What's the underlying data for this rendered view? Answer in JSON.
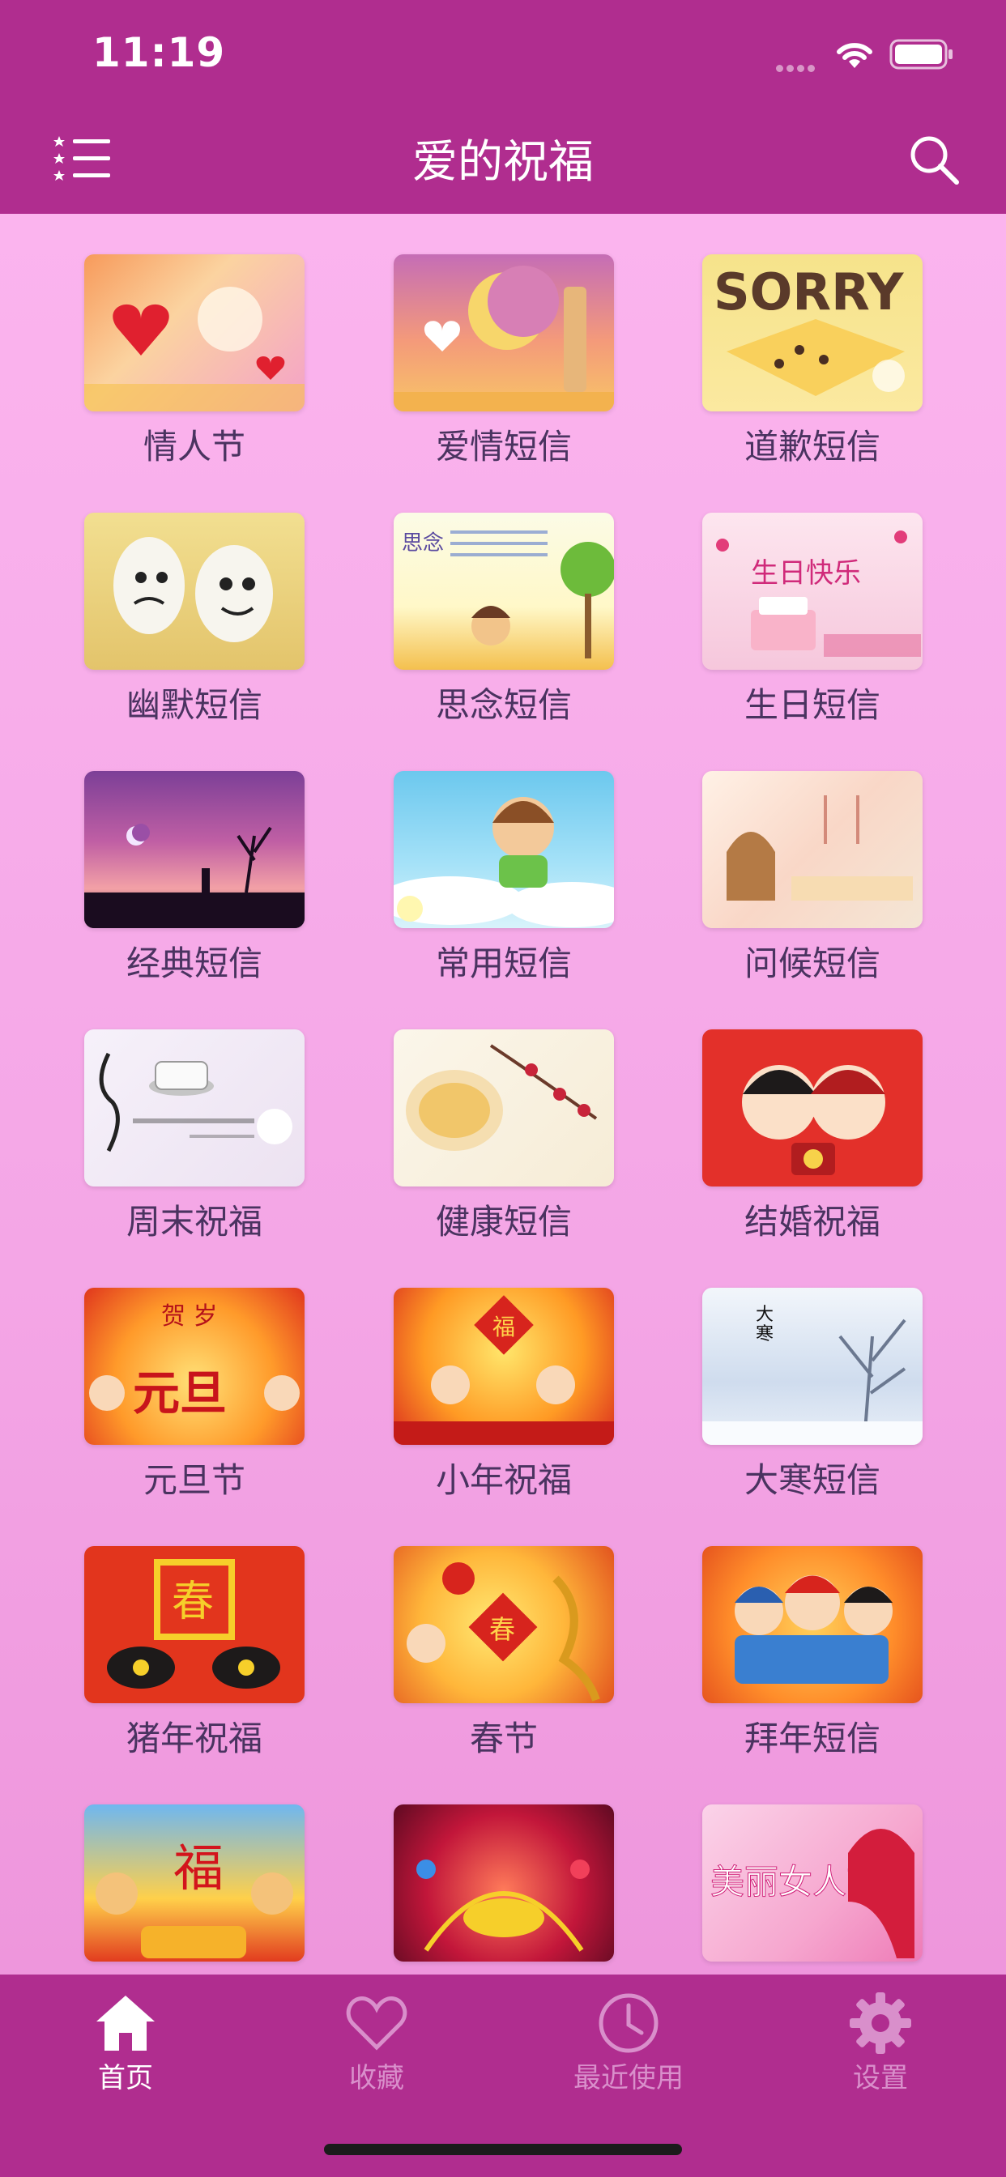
{
  "status_bar": {
    "time": "11:19"
  },
  "header": {
    "title": "爱的祝福"
  },
  "categories": [
    {
      "label": "情人节"
    },
    {
      "label": "爱情短信"
    },
    {
      "label": "道歉短信"
    },
    {
      "label": "幽默短信"
    },
    {
      "label": "思念短信"
    },
    {
      "label": "生日短信"
    },
    {
      "label": "经典短信"
    },
    {
      "label": "常用短信"
    },
    {
      "label": "问候短信"
    },
    {
      "label": "周末祝福"
    },
    {
      "label": "健康短信"
    },
    {
      "label": "结婚祝福"
    },
    {
      "label": "元旦节"
    },
    {
      "label": "小年祝福"
    },
    {
      "label": "大寒短信"
    },
    {
      "label": "猪年祝福"
    },
    {
      "label": "春节"
    },
    {
      "label": "拜年短信"
    },
    {
      "label": ""
    },
    {
      "label": ""
    },
    {
      "label": ""
    }
  ],
  "tabbar": {
    "tabs": [
      {
        "label": "首页",
        "icon": "home-icon",
        "active": true
      },
      {
        "label": "收藏",
        "icon": "heart-icon",
        "active": false
      },
      {
        "label": "最近使用",
        "icon": "clock-icon",
        "active": false
      },
      {
        "label": "设置",
        "icon": "gear-icon",
        "active": false
      }
    ]
  },
  "theme": {
    "header_bg": "#b02d8f",
    "content_bg": "#f4a6e6",
    "tab_active": "#ffffff",
    "tab_inactive": "#d98fcb",
    "label_color": "#4a3360"
  }
}
